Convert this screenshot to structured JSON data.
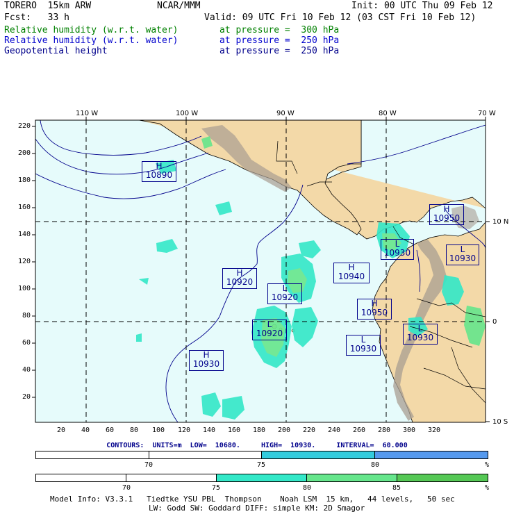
{
  "header": {
    "line1_left": "TORERO  15km ARW",
    "line1_mid": "NCAR/MMM",
    "line1_right": "Init: 00 UTC Thu 09 Feb 12",
    "line2_left": "Fcst:   33 h",
    "line2_right": "Valid: 09 UTC Fri 10 Feb 12 (03 CST Fri 10 Feb 12)",
    "fields": [
      {
        "name": "Relative humidity (w.r.t. water)",
        "level": "at pressure =  300 hPa",
        "color": "#008000"
      },
      {
        "name": "Relative humidity (w.r.t. water)",
        "level": "at pressure =  250 hPa",
        "color": "#0000cd"
      },
      {
        "name": "Geopotential height",
        "level": "at pressure =  250 hPa",
        "color": "#00008b"
      }
    ]
  },
  "map": {
    "lon_labels": [
      "110 W",
      "100 W",
      "90 W",
      "80 W",
      "70 W"
    ],
    "lat_labels_right": [
      "10 N",
      "0",
      "10 S"
    ],
    "y_ticks": [
      "220",
      "200",
      "180",
      "160",
      "140",
      "120",
      "100",
      "80",
      "60",
      "40",
      "20"
    ],
    "x_ticks": [
      "20",
      "40",
      "60",
      "80",
      "100",
      "120",
      "140",
      "160",
      "180",
      "200",
      "220",
      "240",
      "260",
      "280",
      "300",
      "320"
    ],
    "centers": [
      {
        "type": "H",
        "value": "10890"
      },
      {
        "type": "H",
        "value": "10950"
      },
      {
        "type": "L",
        "value": "10930"
      },
      {
        "type": "L",
        "value": "10930"
      },
      {
        "type": "H",
        "value": "10920"
      },
      {
        "type": "L",
        "value": "10920"
      },
      {
        "type": "H",
        "value": "10940"
      },
      {
        "type": "H",
        "value": "10950"
      },
      {
        "type": "L",
        "value": "10920"
      },
      {
        "type": "L",
        "value": "10930"
      },
      {
        "type": "L",
        "value": "10930"
      },
      {
        "type": "H",
        "value": "10930"
      }
    ],
    "colors": {
      "ocean": "#e6fbfb",
      "land": "#f3d9a8",
      "mountain": "#a89d92",
      "contour": "#00008b"
    }
  },
  "contour_label": "CONTOURS:  UNITS=m  LOW=  10680.     HIGH=  10930.     INTERVAL=  60.000",
  "colorbar_250": {
    "labels": [
      "70",
      "75",
      "80",
      "%"
    ],
    "colors": [
      "#ffffff",
      "#ffffff",
      "#33ccdd",
      "#5599ee"
    ]
  },
  "colorbar_300": {
    "labels": [
      "70",
      "75",
      "80",
      "85",
      "%"
    ],
    "colors": [
      "#ffffff",
      "#ffffff",
      "#33e8c8",
      "#66e68c",
      "#55c855"
    ]
  },
  "footer": {
    "line1": "Model Info: V3.3.1   Tiedtke YSU PBL  Thompson    Noah LSM  15 km,   44 levels,   50 sec",
    "line2": "LW: Godd SW: Goddard DIFF: simple KM: 2D Smagor"
  }
}
